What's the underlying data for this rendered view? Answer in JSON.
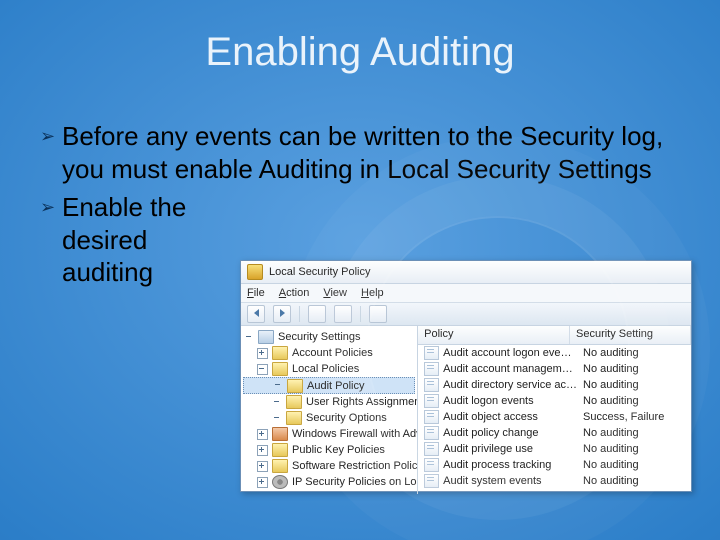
{
  "title": "Enabling Auditing",
  "bullets": [
    "Before any events can be written to the Security log, you must enable Auditing in Local Security Settings",
    "Enable the desired auditing"
  ],
  "window": {
    "title": "Local Security Policy",
    "menu": {
      "file": "File",
      "action": "Action",
      "view": "View",
      "help": "Help"
    },
    "columns": {
      "policy": "Policy",
      "setting": "Security Setting"
    },
    "tree": {
      "root": "Security Settings",
      "items": [
        "Account Policies",
        "Local Policies",
        "Audit Policy",
        "User Rights Assignment",
        "Security Options",
        "Windows Firewall with Advanc",
        "Public Key Policies",
        "Software Restriction Policies",
        "IP Security Policies on Local C"
      ]
    },
    "policies": [
      {
        "name": "Audit account logon eve…",
        "setting": "No auditing"
      },
      {
        "name": "Audit account managem…",
        "setting": "No auditing"
      },
      {
        "name": "Audit directory service ac…",
        "setting": "No auditing"
      },
      {
        "name": "Audit logon events",
        "setting": "No auditing"
      },
      {
        "name": "Audit object access",
        "setting": "Success, Failure"
      },
      {
        "name": "Audit policy change",
        "setting": "No auditing"
      },
      {
        "name": "Audit privilege use",
        "setting": "No auditing"
      },
      {
        "name": "Audit process tracking",
        "setting": "No auditing"
      },
      {
        "name": "Audit system events",
        "setting": "No auditing"
      }
    ]
  }
}
